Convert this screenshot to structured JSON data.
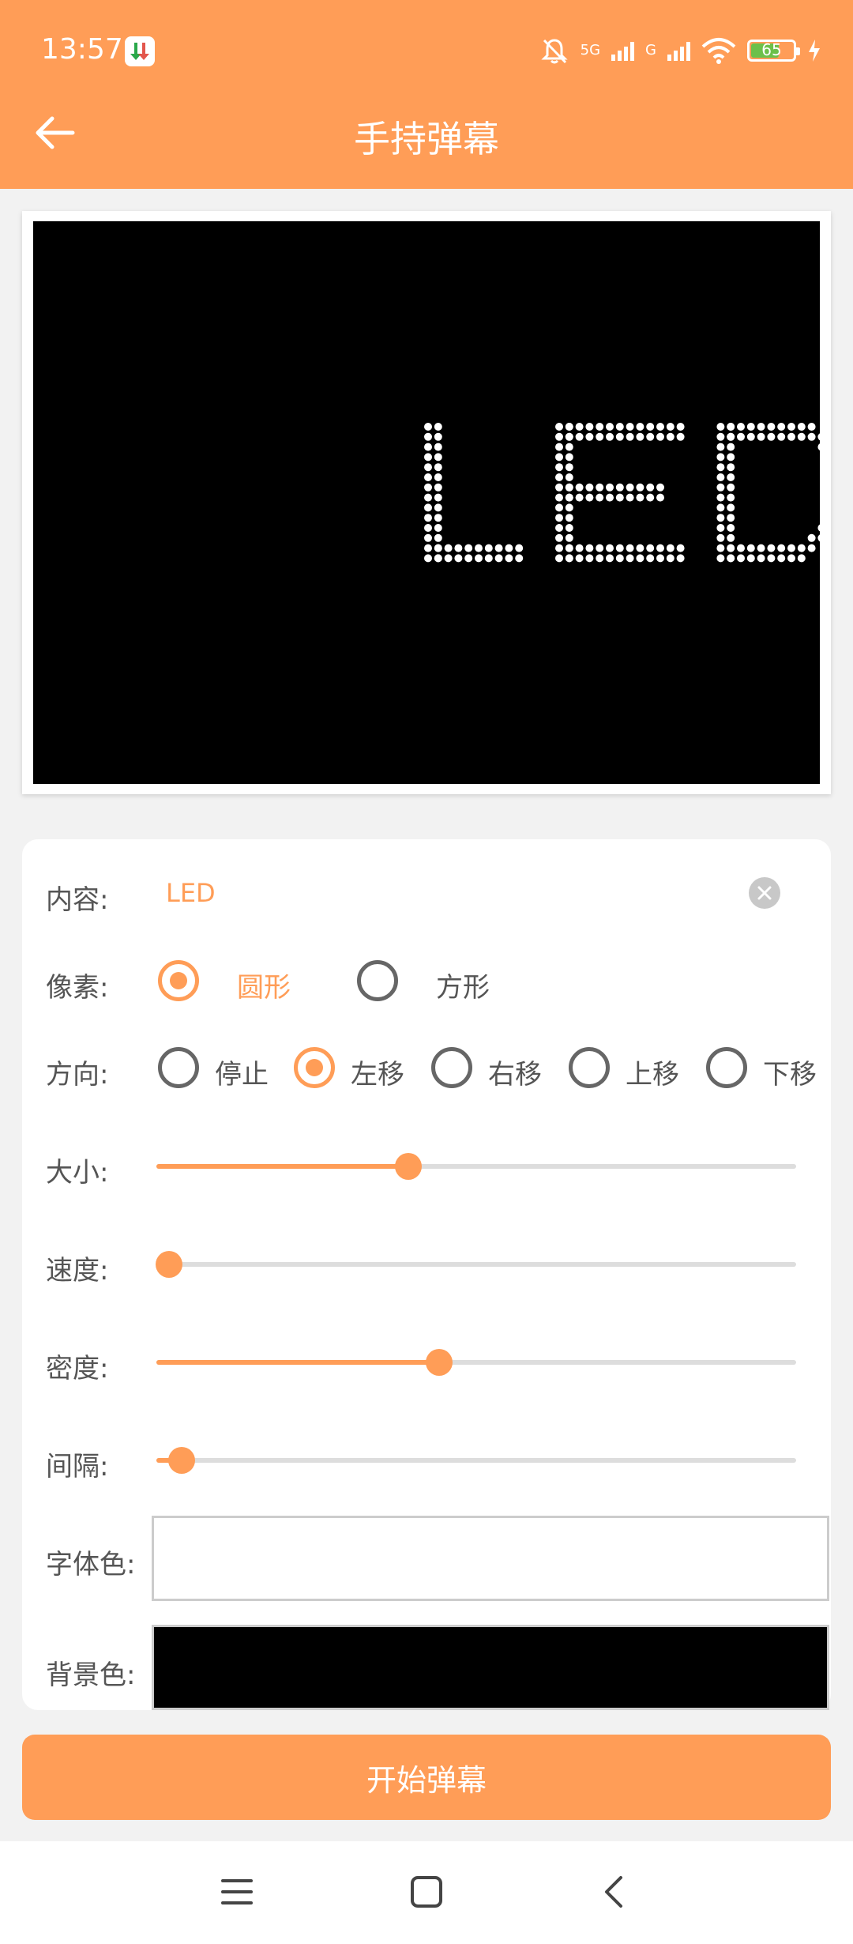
{
  "status": {
    "time": "13:57",
    "battery": "65",
    "battery_level": 0.65,
    "net_5g": "5G",
    "net_g": "G"
  },
  "toolbar": {
    "title": "手持弹幕"
  },
  "preview": {
    "text": "LED",
    "background": "#000000",
    "dot_color": "#ffffff"
  },
  "settings": {
    "content_label": "内容:",
    "content_value": "LED",
    "pixel_label": "像素:",
    "pixel_options": [
      "圆形",
      "方形"
    ],
    "pixel_selected": "圆形",
    "direction_label": "方向:",
    "direction_options": [
      "停止",
      "左移",
      "右移",
      "上移",
      "下移"
    ],
    "direction_selected": "左移",
    "size_label": "大小:",
    "size_level": 0.39,
    "speed_label": "速度:",
    "speed_level": 0.0,
    "density_label": "密度:",
    "density_level": 0.44,
    "interval_label": "间隔:",
    "interval_level": 0.02,
    "font_color_label": "字体色:",
    "font_color": "#ffffff",
    "bg_color_label": "背景色:",
    "bg_color": "#000000"
  },
  "actions": {
    "start_label": "开始弹幕"
  },
  "theme": {
    "accent": "#FF9D57"
  },
  "icons": {
    "back": "arrow-left-icon",
    "clear": "close-circle-icon",
    "nav_menu": "menu-icon",
    "nav_home": "square-icon",
    "nav_back": "chevron-left-icon"
  }
}
